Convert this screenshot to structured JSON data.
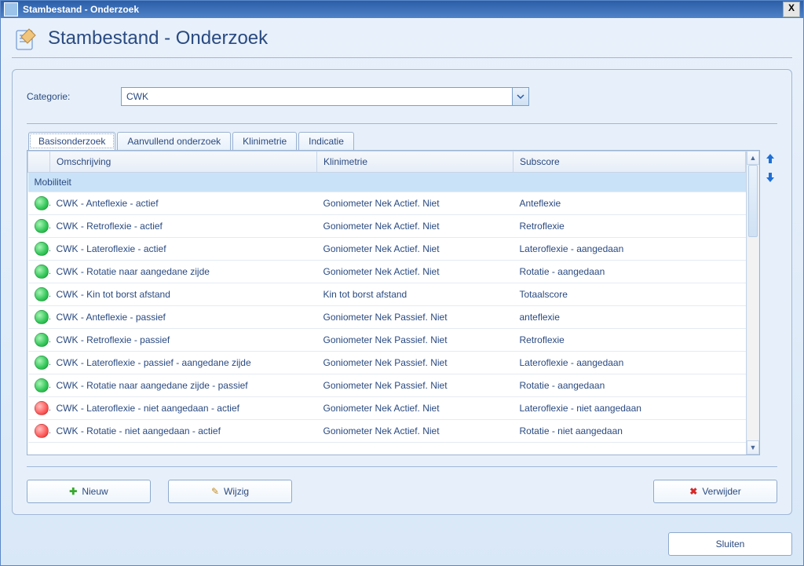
{
  "window": {
    "title": "Stambestand - Onderzoek",
    "close": "X"
  },
  "header": {
    "title": "Stambestand - Onderzoek"
  },
  "category": {
    "label": "Categorie:",
    "value": "CWK"
  },
  "tabs": [
    {
      "label": "Basisonderzoek",
      "active": true
    },
    {
      "label": "Aanvullend onderzoek",
      "active": false
    },
    {
      "label": "Klinimetrie",
      "active": false
    },
    {
      "label": "Indicatie",
      "active": false
    }
  ],
  "columns": {
    "description": "Omschrijving",
    "klin": "Klinimetrie",
    "sub": "Subscore"
  },
  "group_label": "Mobiliteit",
  "rows": [
    {
      "status": "green",
      "desc": "CWK - Anteflexie - actief",
      "klin": "Goniometer Nek Actief. Niet",
      "sub": "Anteflexie"
    },
    {
      "status": "green",
      "desc": "CWK - Retroflexie - actief",
      "klin": "Goniometer Nek Actief. Niet",
      "sub": "Retroflexie"
    },
    {
      "status": "green",
      "desc": "CWK - Lateroflexie - actief",
      "klin": "Goniometer Nek Actief. Niet",
      "sub": "Lateroflexie - aangedaan"
    },
    {
      "status": "green",
      "desc": "CWK - Rotatie naar aangedane zijde",
      "klin": "Goniometer Nek Actief. Niet",
      "sub": "Rotatie - aangedaan"
    },
    {
      "status": "green",
      "desc": "CWK - Kin tot borst afstand",
      "klin": "Kin tot borst afstand",
      "sub": "Totaalscore"
    },
    {
      "status": "green",
      "desc": "CWK - Anteflexie - passief",
      "klin": "Goniometer Nek Passief. Niet",
      "sub": "anteflexie"
    },
    {
      "status": "green",
      "desc": "CWK - Retroflexie - passief",
      "klin": "Goniometer Nek Passief. Niet",
      "sub": "Retroflexie"
    },
    {
      "status": "green",
      "desc": "CWK - Lateroflexie - passief - aangedane zijde",
      "klin": "Goniometer Nek Passief. Niet",
      "sub": "Lateroflexie - aangedaan"
    },
    {
      "status": "green",
      "desc": "CWK - Rotatie naar aangedane zijde - passief",
      "klin": "Goniometer Nek Passief. Niet",
      "sub": "Rotatie - aangedaan"
    },
    {
      "status": "red",
      "desc": "CWK - Lateroflexie - niet aangedaan - actief",
      "klin": "Goniometer Nek Actief. Niet",
      "sub": "Lateroflexie - niet aangedaan"
    },
    {
      "status": "red",
      "desc": "CWK - Rotatie - niet aangedaan - actief",
      "klin": "Goniometer Nek Actief. Niet",
      "sub": "Rotatie - niet aangedaan"
    }
  ],
  "buttons": {
    "new": "Nieuw",
    "edit": "Wijzig",
    "delete": "Verwijder",
    "close": "Sluiten"
  }
}
